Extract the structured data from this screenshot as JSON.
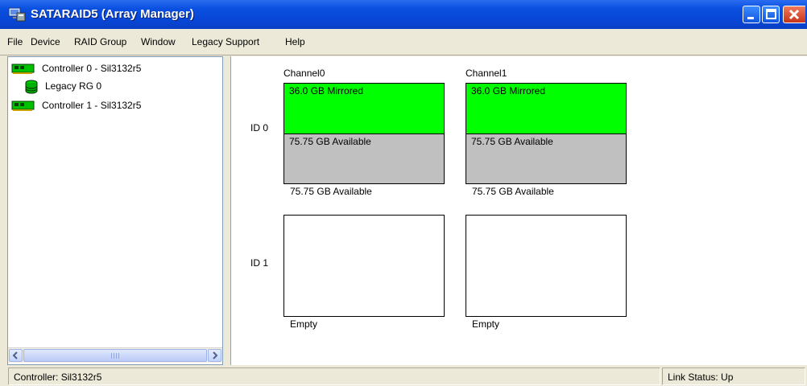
{
  "window": {
    "title": "SATARAID5 (Array Manager)",
    "app_icon": "computer-icon",
    "buttons": [
      "minimize-icon",
      "maximize-icon",
      "close-icon"
    ]
  },
  "menu": {
    "file": "File",
    "device": "Device",
    "raid_group": "RAID Group",
    "window": "Window",
    "legacy_support": "Legacy Support",
    "help": "Help"
  },
  "tree": {
    "items": [
      {
        "label": "Controller 0 - Sil3132r5",
        "icon": "controller-card-icon"
      },
      {
        "label": "Legacy RG 0",
        "icon": "database-icon"
      },
      {
        "label": "Controller 1 - Sil3132r5",
        "icon": "controller-card-icon"
      }
    ]
  },
  "channels": [
    "Channel0",
    "Channel1"
  ],
  "rows": [
    "ID 0",
    "ID 1"
  ],
  "disks": {
    "ch0_id0": {
      "segment1": "36.0 GB Mirrored",
      "segment2": "75.75 GB Available",
      "caption": "75.75 GB Available"
    },
    "ch1_id0": {
      "segment1": "36.0 GB Mirrored",
      "segment2": "75.75 GB Available",
      "caption": "75.75 GB Available"
    },
    "ch0_id1": {
      "caption": "Empty"
    },
    "ch1_id1": {
      "caption": "Empty"
    }
  },
  "status": {
    "controller": "Controller: Sil3132r5",
    "link": "Link Status: Up"
  },
  "colors": {
    "mirrored": "#00ff00",
    "available": "#c0c0c0",
    "titlebar": "#0a50e0"
  }
}
